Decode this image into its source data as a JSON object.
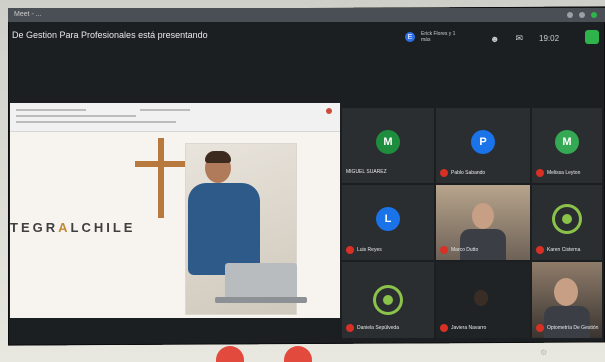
{
  "window": {
    "tab_text": "Meet - ...",
    "presenting_text": "De Gestion Para Profesionales está presentando"
  },
  "top_right": {
    "mini_avatar_letter": "E",
    "mini_name": "Erick Flores y 1 más",
    "clock": "19:02",
    "icons": [
      "people-icon",
      "chat-icon"
    ]
  },
  "slide": {
    "brand_pre": "TEGR",
    "brand_accent": "A",
    "brand_post": "LCHILE"
  },
  "participants": [
    {
      "letter": "M",
      "name": "MIGUEL SUAREZ",
      "color": "#1e8e3e",
      "muted": false
    },
    {
      "letter": "P",
      "name": "Pablo Sabando",
      "color": "#1a73e8",
      "muted": true
    },
    {
      "letter": "M",
      "name": "Melissa Leyton",
      "color": "#34a853",
      "muted": true
    },
    {
      "letter": "L",
      "name": "Luis Reyes",
      "color": "#1a73e8",
      "muted": true
    },
    {
      "letter": "",
      "name": "Marco Dutto",
      "color": "",
      "muted": true
    },
    {
      "letter": "",
      "name": "Karen Cisterna",
      "color": "#8bc34a",
      "muted": true
    },
    {
      "letter": "",
      "name": "Daniela Sepúlveda",
      "color": "#8bc34a",
      "muted": true
    },
    {
      "letter": "",
      "name": "Javiera Navarro",
      "color": "",
      "muted": true
    },
    {
      "letter": "",
      "name": "Optometría De Gestión",
      "color": "",
      "muted": true
    }
  ],
  "colors": {
    "meeting_bg": "#1c1f22",
    "mic_off": "#d93025",
    "leave_button": "#e34a3e"
  }
}
